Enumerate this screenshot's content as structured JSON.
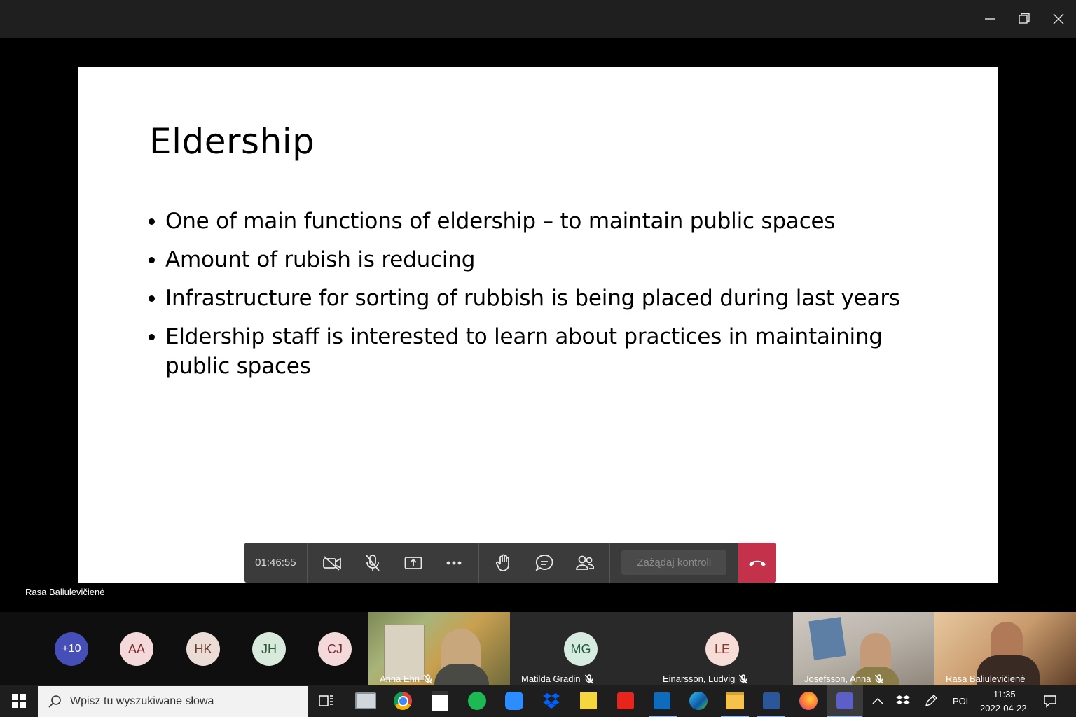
{
  "slide": {
    "title": "Eldership",
    "bullets": [
      "One of main functions of eldership – to maintain public spaces",
      "Amount of rubish is reducing",
      "Infrastructure for sorting of rubbish is being placed during last years",
      "Eldership staff is interested to learn about practices in maintaining public spaces"
    ]
  },
  "controls": {
    "timer": "01:46:55",
    "request_control_label": "Zażądaj kontroli"
  },
  "presenter": {
    "name": "Rasa Baliulevičienė"
  },
  "participants": {
    "overflow": "+10",
    "avatars": [
      {
        "initials": "AA",
        "bg": "#f3d9da",
        "fg": "#7a2a2f"
      },
      {
        "initials": "HK",
        "bg": "#ecdcd6",
        "fg": "#6b3f32"
      },
      {
        "initials": "JH",
        "bg": "#d7eadb",
        "fg": "#2c5a37"
      },
      {
        "initials": "CJ",
        "bg": "#f3d9da",
        "fg": "#7a2a2f"
      }
    ],
    "tiles": [
      {
        "name": "Anna Ehn",
        "type": "video"
      },
      {
        "name": "Matilda Gradin",
        "type": "avatar",
        "initials": "MG",
        "bg": "#d6ece0",
        "fg": "#255b3d"
      },
      {
        "name": "Einarsson, Ludvig",
        "type": "avatar",
        "initials": "LE",
        "bg": "#f6ddd7",
        "fg": "#8a3a2a"
      },
      {
        "name": "Josefsson, Anna",
        "type": "video"
      },
      {
        "name": "Rasa Baliulevičienė",
        "type": "video"
      }
    ]
  },
  "taskbar": {
    "search_placeholder": "Wpisz tu wyszukiwane słowa",
    "language": "POL",
    "time": "11:35",
    "date": "2022-04-22"
  },
  "colors": {
    "hangup": "#c4314b",
    "overflow_avatar": "#464eb8"
  }
}
